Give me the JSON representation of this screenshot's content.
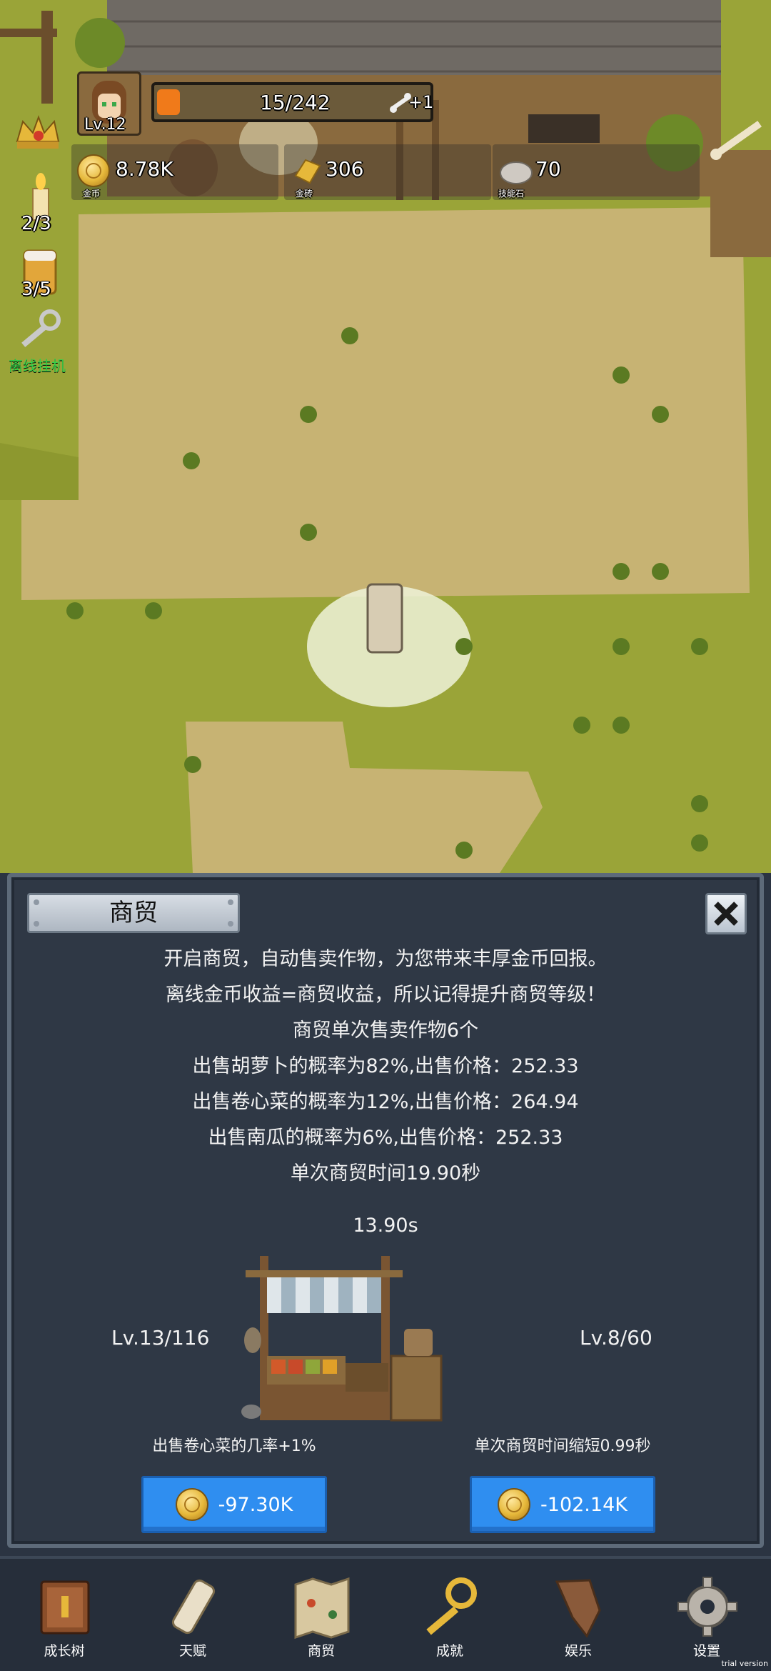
{
  "hud": {
    "player_level": "Lv.12",
    "xp_text": "15/242",
    "xp_progress": 0.06,
    "bonus_text": "+1",
    "resources": [
      {
        "icon": "gold-coin-icon",
        "value": "8.78K",
        "label": "金币"
      },
      {
        "icon": "gold-brick-icon",
        "value": "306",
        "label": "金砖"
      },
      {
        "icon": "skill-stone-icon",
        "value": "70",
        "label": "技能石"
      }
    ],
    "side_items": [
      {
        "icon": "crown-icon",
        "count": ""
      },
      {
        "icon": "candle-icon",
        "count": "2/3"
      },
      {
        "icon": "beer-icon",
        "count": "3/5"
      },
      {
        "icon": "key-icon",
        "count": "",
        "label": "离线挂机"
      }
    ]
  },
  "panel": {
    "title": "商贸",
    "description": [
      "开启商贸，自动售卖作物，为您带来丰厚金币回报。",
      "离线金币收益=商贸收益，所以记得提升商贸等级！",
      "商贸单次售卖作物6个",
      "出售胡萝卜的概率为82%,出售价格：252.33",
      "出售卷心菜的概率为12%,出售价格：264.94",
      "出售南瓜的概率为6%,出售价格：252.33",
      "单次商贸时间19.90秒"
    ],
    "timer": "13.90s",
    "left_level": "Lv.13/116",
    "right_level": "Lv.8/60",
    "left_upgrade": {
      "label": "出售卷心菜的几率+1%",
      "cost": "-97.30K"
    },
    "right_upgrade": {
      "label": "单次商贸时间缩短0.99秒",
      "cost": "-102.14K"
    }
  },
  "nav": [
    {
      "icon": "book-icon",
      "label": "成长树"
    },
    {
      "icon": "scroll-icon",
      "label": "天赋"
    },
    {
      "icon": "map-icon",
      "label": "商贸"
    },
    {
      "icon": "golden-key-icon",
      "label": "成就"
    },
    {
      "icon": "paper-icon",
      "label": "娱乐"
    },
    {
      "icon": "gear-icon",
      "label": "设置"
    }
  ],
  "watermark": "trial version",
  "colors": {
    "panel_bg": "#2f3845",
    "button_blue": "#2f8ef0",
    "grass": "#9aa438",
    "dirt": "#c7b373"
  }
}
